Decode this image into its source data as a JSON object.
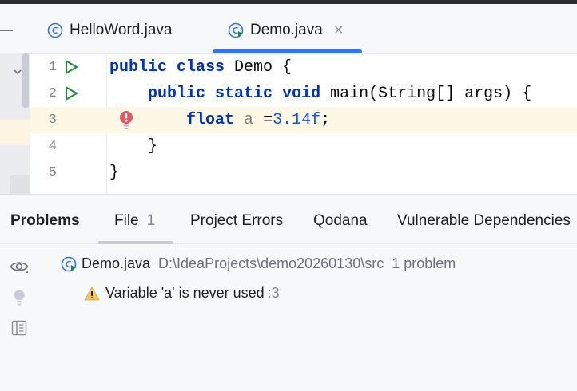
{
  "editor_tabs": [
    {
      "label": "HelloWord.java",
      "active": false
    },
    {
      "label": "Demo.java",
      "active": true,
      "close_glyph": "×"
    }
  ],
  "code_lines": [
    {
      "number": "1",
      "run_icon": true
    },
    {
      "number": "2",
      "run_icon": true
    },
    {
      "number": "3",
      "error_icon": true,
      "highlighted": true
    },
    {
      "number": "4"
    },
    {
      "number": "5"
    }
  ],
  "code_tokens": {
    "l1_kw1": "public",
    "l1_kw2": "class",
    "l1_rest": " Demo {",
    "l2_kw1": "public",
    "l2_kw2": "static",
    "l2_kw3": "void",
    "l2_rest": " main(String[] args) {",
    "l3_kw": "float",
    "l3_var": "a",
    "l3_eq": " =",
    "l3_num": "3.14f",
    "l3_end": ";",
    "l4": "}",
    "l5": "}"
  },
  "problems_panel": {
    "title": "Problems",
    "tabs": [
      {
        "label": "File",
        "count": "1",
        "active": true
      },
      {
        "label": "Project Errors"
      },
      {
        "label": "Qodana"
      },
      {
        "label": "Vulnerable Dependencies"
      }
    ],
    "file_node": {
      "name": "Demo.java",
      "path": "D:\\IdeaProjects\\demo20260130\\src",
      "count": "1 problem"
    },
    "problem": {
      "message": "Variable 'a' is never used",
      "line_ref": ":3"
    }
  },
  "icons": {
    "java_class": "class-file-icon",
    "run": "run-gutter-icon",
    "error": "error-bulb-icon",
    "warning": "warning-icon",
    "eye": "eye-icon",
    "bulb": "bulb-icon",
    "preview": "preview-icon"
  },
  "colors": {
    "accent": "#3574f0",
    "keyword": "#0033b3",
    "number": "#1750eb",
    "run_green": "#208a3c",
    "error_red": "#e55765",
    "warning_yellow": "#f2c55c"
  }
}
